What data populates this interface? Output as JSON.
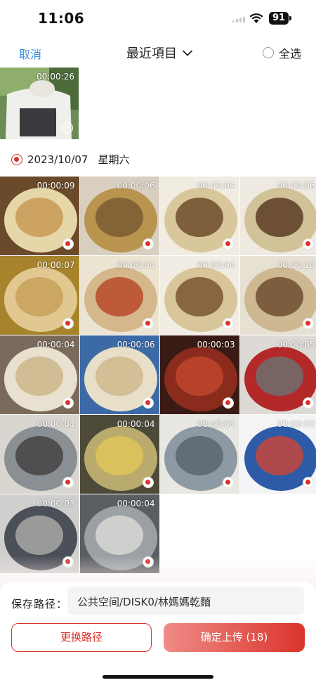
{
  "status": {
    "time": "11:06",
    "battery": "91"
  },
  "header": {
    "cancel": "取消",
    "title": "最近項目",
    "select_all": "全选"
  },
  "top_item": {
    "duration": "00:00:26",
    "selected": false
  },
  "date_group": {
    "date": "2023/10/07",
    "weekday": "星期六",
    "selected": true
  },
  "items": [
    {
      "duration": "00:00:09",
      "selected": true
    },
    {
      "duration": "00:00:06",
      "selected": true
    },
    {
      "duration": "00:00:04",
      "selected": true
    },
    {
      "duration": "00:00:06",
      "selected": true
    },
    {
      "duration": "00:00:07",
      "selected": true
    },
    {
      "duration": "00:00:04",
      "selected": true
    },
    {
      "duration": "00:00:04",
      "selected": true
    },
    {
      "duration": "00:00:10",
      "selected": true
    },
    {
      "duration": "00:00:04",
      "selected": true
    },
    {
      "duration": "00:00:06",
      "selected": true
    },
    {
      "duration": "00:00:03",
      "selected": true
    },
    {
      "duration": "00:00:05",
      "selected": true
    },
    {
      "duration": "00:00:04",
      "selected": true
    },
    {
      "duration": "00:00:04",
      "selected": true
    },
    {
      "duration": "00:00:04",
      "selected": true
    },
    {
      "duration": "00:00:03",
      "selected": true
    },
    {
      "duration": "00:00:03",
      "selected": true
    },
    {
      "duration": "00:00:04",
      "selected": true
    }
  ],
  "footer": {
    "path_label": "保存路径：",
    "path_value": "公共空间/DISK0/林媽媽乾麵",
    "change_button": "更换路径",
    "upload_button": "确定上传 (18)"
  },
  "colors": {
    "accent": "#d9342b",
    "link": "#3d8ee0"
  }
}
